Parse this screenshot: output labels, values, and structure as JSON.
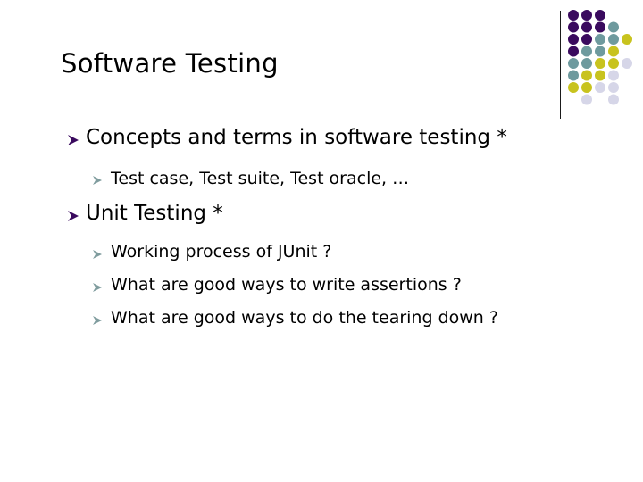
{
  "slide": {
    "title": "Software Testing",
    "bullets": [
      {
        "level": 1,
        "text": "Concepts and terms in software testing *",
        "children": [
          {
            "level": 2,
            "text": "Test case, Test suite,  Test oracle, …"
          }
        ]
      },
      {
        "level": 1,
        "text": "Unit Testing *",
        "children": [
          {
            "level": 2,
            "text": "Working process of JUnit ?"
          },
          {
            "level": 2,
            "text": "What are good ways to write assertions ?"
          },
          {
            "level": 2,
            "text": "What are good ways to do the tearing down ?"
          }
        ]
      }
    ]
  },
  "theme": {
    "bullet_level1_color": "#3a0a5e",
    "bullet_level2_color": "#7f9c9e",
    "dot_colors": {
      "P": "#3a0a5e",
      "T": "#6e9a9e",
      "Y": "#c8c31e",
      "L": "#d6d6e8"
    },
    "dot_grid": [
      "PPP__",
      "PPPT_",
      "PPTTY",
      "PTTY_",
      "TTYYL",
      "TYYL_",
      "YYLL_",
      "_L_L_"
    ]
  },
  "icons": {
    "bullet": "arrowhead-bullet-icon",
    "decoration": "dot-grid-decoration"
  }
}
